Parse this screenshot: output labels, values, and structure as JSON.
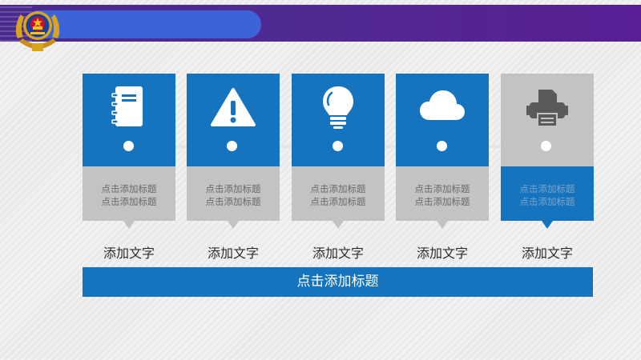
{
  "colors": {
    "accent_blue": "#1574bd",
    "card_gray": "#c3c3c3",
    "header_purple": "#4f2a92",
    "header_pill": "#3c63d8"
  },
  "cards": [
    {
      "icon": "notebook-icon",
      "subtitle_line1": "点击添加标题",
      "subtitle_line2": "点击添加标题",
      "label": "添加文字",
      "highlight": false
    },
    {
      "icon": "warning-icon",
      "subtitle_line1": "点击添加标题",
      "subtitle_line2": "点击添加标题",
      "label": "添加文字",
      "highlight": false
    },
    {
      "icon": "lightbulb-icon",
      "subtitle_line1": "点击添加标题",
      "subtitle_line2": "点击添加标题",
      "label": "添加文字",
      "highlight": false
    },
    {
      "icon": "cloud-icon",
      "subtitle_line1": "点击添加标题",
      "subtitle_line2": "点击添加标题",
      "label": "添加文字",
      "highlight": false
    },
    {
      "icon": "printer-icon",
      "subtitle_line1": "点击添加标题",
      "subtitle_line2": "点击添加标题",
      "label": "添加文字",
      "highlight": true
    }
  ],
  "banner": {
    "title": "点击添加标题"
  }
}
